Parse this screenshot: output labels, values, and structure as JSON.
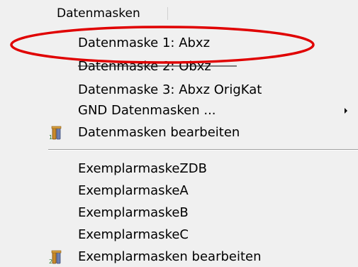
{
  "menu": {
    "title": "Datenmasken",
    "items": [
      {
        "label": "Datenmaske 1: Abxz"
      },
      {
        "label": "Datenmaske 2: Obxz"
      },
      {
        "label": "Datenmaske 3: Abxz OrigKat"
      },
      {
        "label": "GND Datenmasken ..."
      },
      {
        "label": "Datenmasken bearbeiten",
        "icon": "tools-icon",
        "icon_badge": "1"
      },
      {
        "label": "ExemplarmaskeZDB"
      },
      {
        "label": "ExemplarmaskeA"
      },
      {
        "label": "ExemplarmaskeB"
      },
      {
        "label": "ExemplarmaskeC"
      },
      {
        "label": "Exemplarmasken bearbeiten",
        "icon": "tools-icon",
        "icon_badge": "2"
      }
    ]
  },
  "annotation": {
    "color": "#e00000",
    "target": "Datenmaske 1: Abxz"
  },
  "colors": {
    "background": "#f0f0f0",
    "separator": "#a0a0a0"
  }
}
